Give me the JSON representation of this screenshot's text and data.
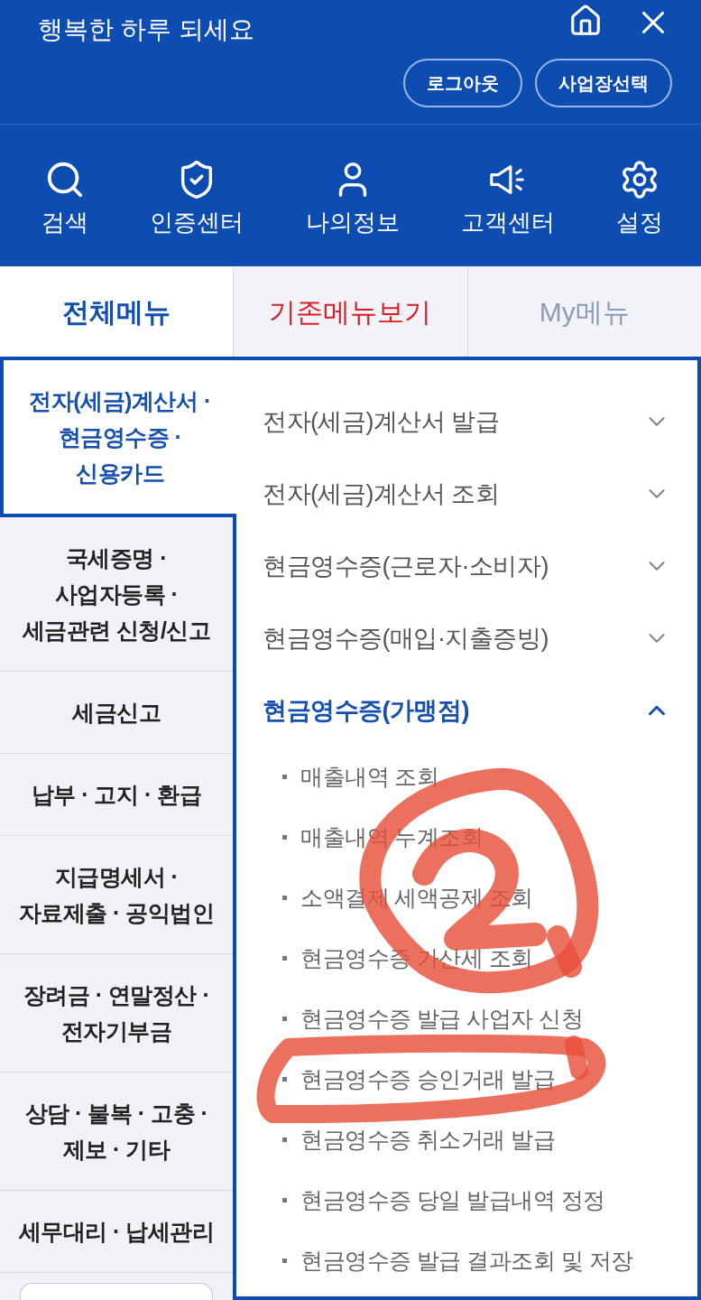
{
  "header": {
    "greeting": "행복한 하루 되세요",
    "buttons": [
      "로그아웃",
      "사업장선택"
    ],
    "shortcuts": [
      "검색",
      "인증센터",
      "나의정보",
      "고객센터",
      "설정"
    ]
  },
  "tabs": [
    {
      "label": "전체메뉴",
      "selected": true,
      "kind": "normal"
    },
    {
      "label": "기존메뉴보기",
      "selected": false,
      "kind": "highlight"
    },
    {
      "label": "My메뉴",
      "selected": false,
      "kind": "normal"
    }
  ],
  "categories": [
    {
      "label": "전자(세금)계산서 ·\n현금영수증 ·\n신용카드",
      "selected": true
    },
    {
      "label": "국세증명 ·\n사업자등록 ·\n세금관련 신청/신고",
      "selected": false
    },
    {
      "label": "세금신고",
      "selected": false
    },
    {
      "label": "납부 · 고지 · 환급",
      "selected": false
    },
    {
      "label": "지급명세서 ·\n자료제출 · 공익법인",
      "selected": false
    },
    {
      "label": "장려금 · 연말정산 ·\n전자기부금",
      "selected": false
    },
    {
      "label": "상담 · 불복 · 고충 ·\n제보 · 기타",
      "selected": false
    },
    {
      "label": "세무대리 · 납세관리",
      "selected": false
    }
  ],
  "menus": [
    {
      "label": "전자(세금)계산서 발급",
      "expanded": false
    },
    {
      "label": "전자(세금)계산서 조회",
      "expanded": false
    },
    {
      "label": "현금영수증(근로자·소비자)",
      "expanded": false
    },
    {
      "label": "현금영수증(매입·지출증빙)",
      "expanded": false
    },
    {
      "label": "현금영수증(가맹점)",
      "expanded": true,
      "children": [
        {
          "label": "매출내역 조회"
        },
        {
          "label": "매출내역 누계조회"
        },
        {
          "label": "소액결제 세액공제 조회"
        },
        {
          "label": "현금영수증 가산세 조회"
        },
        {
          "label": "현금영수증 발급 사업자 신청"
        },
        {
          "label": "현금영수증 승인거래 발급"
        },
        {
          "label": "현금영수증 취소거래 발급"
        },
        {
          "label": "현금영수증 당일 발급내역 정정"
        },
        {
          "label": "현금영수증 발급 결과조회 및 저장"
        }
      ]
    }
  ],
  "annotations": [
    {
      "kind": "circle"
    },
    {
      "kind": "loop"
    }
  ]
}
